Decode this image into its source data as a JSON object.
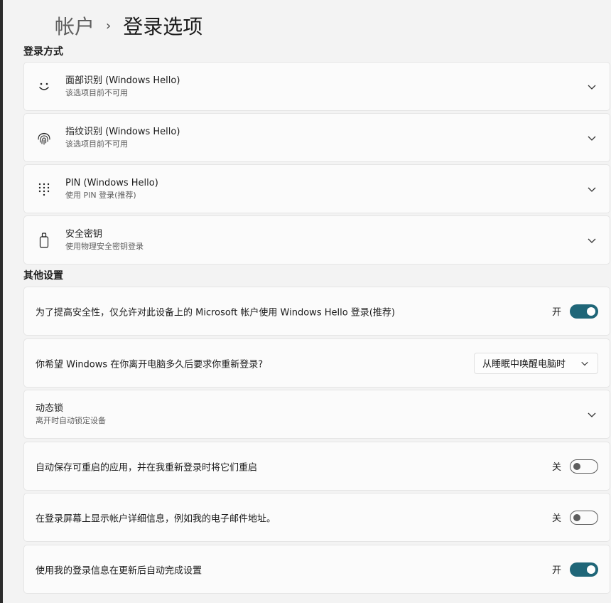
{
  "breadcrumb": {
    "parent": "帐户",
    "separator": "›",
    "current": "登录选项"
  },
  "sections": {
    "sign_in_methods": "登录方式",
    "other_settings": "其他设置"
  },
  "methods": [
    {
      "icon": "face-icon",
      "title": "面部识别 (Windows Hello)",
      "subtitle": "该选项目前不可用"
    },
    {
      "icon": "fingerprint-icon",
      "title": "指纹识别 (Windows Hello)",
      "subtitle": "该选项目前不可用"
    },
    {
      "icon": "pin-keypad-icon",
      "title": "PIN (Windows Hello)",
      "subtitle": "使用 PIN 登录(推荐)"
    },
    {
      "icon": "security-key-icon",
      "title": "安全密钥",
      "subtitle": "使用物理安全密钥登录"
    }
  ],
  "other": {
    "hello_only": {
      "label": "为了提高安全性，仅允许对此设备上的 Microsoft 帐户使用 Windows Hello 登录(推荐)",
      "state": "开"
    },
    "require_signin": {
      "label": "你希望 Windows 在你离开电脑多久后要求你重新登录?",
      "value": "从睡眠中唤醒电脑时"
    },
    "dynamic_lock": {
      "title": "动态锁",
      "subtitle": "离开时自动锁定设备"
    },
    "restart_apps": {
      "label": "自动保存可重启的应用，并在我重新登录时将它们重启",
      "state": "关"
    },
    "account_details": {
      "label": "在登录屏幕上显示帐户详细信息，例如我的电子邮件地址。",
      "state": "关"
    },
    "auto_finish": {
      "label": "使用我的登录信息在更新后自动完成设置",
      "state": "开"
    }
  },
  "colors": {
    "accent": "#1f6678",
    "background": "#f3f3f3",
    "card": "#fbfbfb"
  }
}
